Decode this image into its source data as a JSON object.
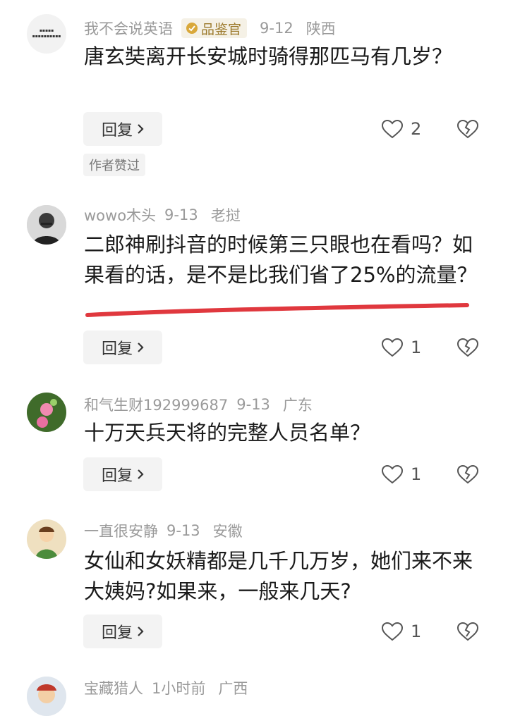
{
  "comments": [
    {
      "username": "我不会说英语",
      "badge": "品鉴官",
      "date": "9-12",
      "location": "陕西",
      "text": "唐玄奘离开长安城时骑得那匹马有几岁？",
      "reply_label": "回复",
      "likes": "2",
      "tag": "作者赞过",
      "avatar_text": "我不会说英语"
    },
    {
      "username": "wowo木头",
      "date": "9-13",
      "location": "老挝",
      "text": "二郎神刷抖音的时候第三只眼也在看吗？如果看的话，是不是比我们省了25%的流量？",
      "reply_label": "回复",
      "likes": "1"
    },
    {
      "username": "和气生财192999687",
      "date": "9-13",
      "location": "广东",
      "text": "十万天兵天将的完整人员名单？",
      "reply_label": "回复",
      "likes": "1"
    },
    {
      "username": "一直很安静",
      "date": "9-13",
      "location": "安徽",
      "text": "女仙和女妖精都是几千几万岁，她们来不来大姨妈?如果来，一般来几天?",
      "reply_label": "回复",
      "likes": "1"
    },
    {
      "username": "宝藏猎人",
      "date": "1小时前",
      "location": "广西"
    }
  ],
  "colors": {
    "meta_text": "#9a9a9a",
    "badge_text": "#9c7a2c",
    "underline": "#e0383e"
  },
  "icons": [
    "heart-outline-icon",
    "broken-heart-icon",
    "chevron-right-icon",
    "verified-badge-icon"
  ]
}
